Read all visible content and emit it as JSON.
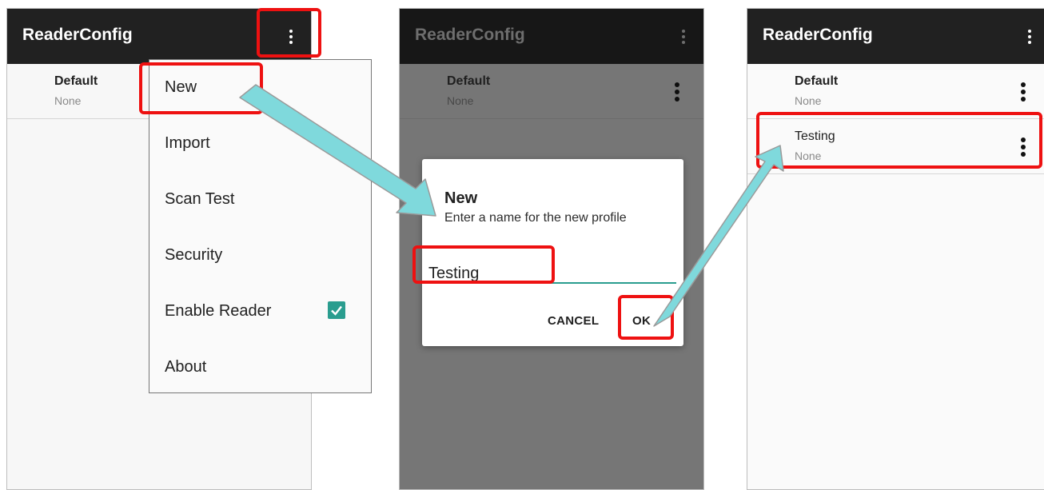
{
  "app_title": "ReaderConfig",
  "profiles_initial": [
    {
      "name": "Default",
      "subtitle": "None"
    }
  ],
  "profiles_after": [
    {
      "name": "Default",
      "subtitle": "None"
    },
    {
      "name": "Testing",
      "subtitle": "None"
    }
  ],
  "menu": {
    "items": [
      "New",
      "Import",
      "Scan Test",
      "Security",
      "Enable Reader",
      "About"
    ],
    "enable_reader_checked": true
  },
  "dialog": {
    "title": "New",
    "message": "Enter a name for the new profile",
    "input_value": "Testing",
    "cancel_label": "CANCEL",
    "ok_label": "OK"
  },
  "icons": {
    "overflow": "more-vert-icon",
    "check": "checkbox-checked-icon",
    "arrow": "callout-arrow-icon"
  },
  "colors": {
    "appbar": "#212121",
    "accent": "#2a9d8f",
    "highlight": "#ee1111",
    "arrow_fill": "#7fd9dc"
  }
}
